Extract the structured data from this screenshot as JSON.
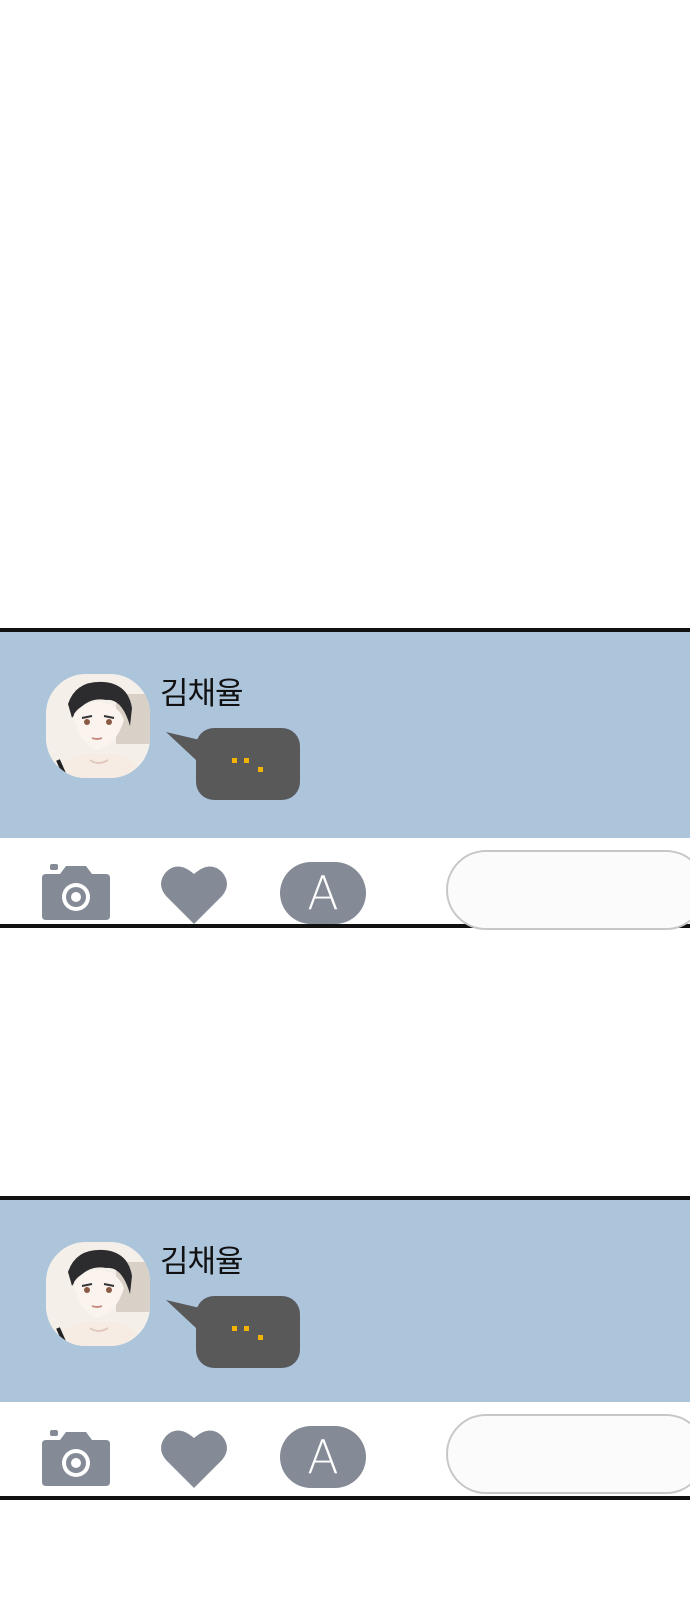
{
  "panels": [
    {
      "sender_name": "김채율",
      "message": "typing-indicator"
    },
    {
      "sender_name": "김채율",
      "message": "typing-indicator"
    }
  ],
  "toolbar": {
    "icons": [
      "camera-icon",
      "heart-icon",
      "font-a-icon"
    ],
    "font_button_label": "A",
    "input_placeholder": ""
  },
  "colors": {
    "chat_background": "#adc5db",
    "bubble": "#595959",
    "typing_dots": "#f4b400",
    "icon_gray": "#858b96",
    "border": "#111111"
  }
}
